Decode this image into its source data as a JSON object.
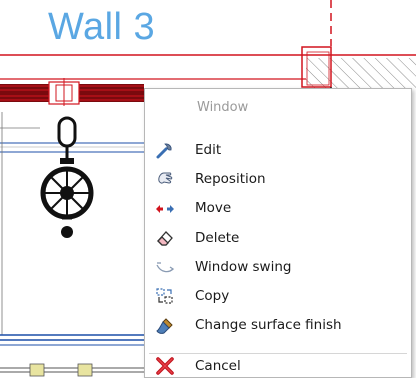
{
  "drawing": {
    "wall_label": "Wall 3"
  },
  "context_menu": {
    "header": "Window",
    "items": [
      {
        "label": "Edit",
        "icon": "wrench-icon"
      },
      {
        "label": "Reposition",
        "icon": "hand-icon"
      },
      {
        "label": "Move",
        "icon": "arrows-move-icon"
      },
      {
        "label": "Delete",
        "icon": "eraser-icon"
      },
      {
        "label": "Window swing",
        "icon": "swing-arc-icon"
      },
      {
        "label": "Copy",
        "icon": "copy-icon"
      },
      {
        "label": "Change surface finish",
        "icon": "paint-brush-icon"
      }
    ],
    "cancel": {
      "label": "Cancel",
      "icon": "red-x-icon"
    }
  },
  "colors": {
    "wall_red": "#d2141e",
    "dark_red": "#7a0a0e",
    "wall_blue": "#5aa7e3",
    "plan_line_blue": "#1c4fa8",
    "menu_text": "#1a1a1a",
    "menu_disabled_text": "#9a9a9a"
  }
}
